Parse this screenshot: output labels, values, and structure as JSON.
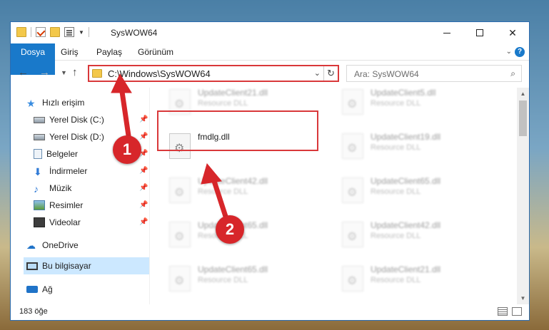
{
  "window": {
    "title": "SysWOW64",
    "minimize_glyph": "—",
    "close_glyph": "✕"
  },
  "ribbon": {
    "tabs": [
      "Dosya",
      "Giriş",
      "Paylaş",
      "Görünüm"
    ]
  },
  "navigation": {
    "address": "C:\\Windows\\SysWOW64",
    "search_placeholder": "Ara: SysWOW64"
  },
  "sidebar": {
    "items": [
      {
        "label": "Hızlı erişim",
        "icon": "star-icon",
        "pinned": false
      },
      {
        "label": "Yerel Disk (C:)",
        "icon": "drive-icon",
        "pinned": true
      },
      {
        "label": "Yerel Disk (D:)",
        "icon": "drive-icon",
        "pinned": true
      },
      {
        "label": "Belgeler",
        "icon": "documents-icon",
        "pinned": true
      },
      {
        "label": "İndirmeler",
        "icon": "downloads-icon",
        "pinned": true
      },
      {
        "label": "Müzik",
        "icon": "music-icon",
        "pinned": true
      },
      {
        "label": "Resimler",
        "icon": "pictures-icon",
        "pinned": true
      },
      {
        "label": "Videolar",
        "icon": "videos-icon",
        "pinned": true
      },
      {
        "label": "OneDrive",
        "icon": "onedrive-icon",
        "pinned": false
      },
      {
        "label": "Bu bilgisayar",
        "icon": "this-pc-icon",
        "pinned": false,
        "selected": true
      },
      {
        "label": "Ağ",
        "icon": "network-icon",
        "pinned": false
      }
    ]
  },
  "files": {
    "left_column": [
      {
        "name": "UpdateClient21.dll",
        "type": "Resource DLL"
      },
      {
        "name": "fmdlg.dll",
        "type": ""
      },
      {
        "name": "UpdateClient42.dll",
        "type": "Resource DLL"
      },
      {
        "name": "UpdateClient65.dll",
        "type": "Resource DLL"
      },
      {
        "name": "UpdateClient65.dll",
        "type": "Resource DLL"
      }
    ],
    "right_column": [
      {
        "name": "UpdateClient5.dll",
        "type": "Resource DLL"
      },
      {
        "name": "UpdateClient19.dll",
        "type": "Resource DLL"
      },
      {
        "name": "UpdateClient65.dll",
        "type": "Resource DLL"
      },
      {
        "name": "UpdateClient42.dll",
        "type": "Resource DLL"
      },
      {
        "name": "UpdateClient21.dll",
        "type": "Resource DLL"
      }
    ]
  },
  "status": {
    "item_count": "183 öğe"
  },
  "callouts": {
    "step1": "1",
    "step2": "2",
    "color": "#d7262a"
  }
}
